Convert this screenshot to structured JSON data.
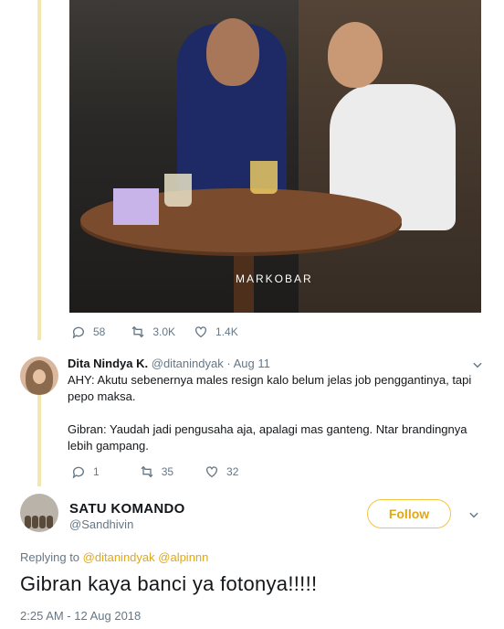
{
  "photo": {
    "watermark": "MARKOBAR"
  },
  "top_tweet_actions": {
    "replies": "58",
    "retweets": "3.0K",
    "likes": "1.4K"
  },
  "reply": {
    "display_name": "Dita Nindya K.",
    "handle": "@ditanindyak",
    "separator": "·",
    "date": "Aug 11",
    "paragraph_1": "AHY: Akutu sebenernya males resign kalo belum jelas job penggantinya, tapi pepo maksa.",
    "paragraph_2": "Gibran: Yaudah jadi pengusaha aja, apalagi mas ganteng. Ntar brandingnya lebih gampang.",
    "replies": "1",
    "retweets": "35",
    "likes": "32"
  },
  "main_tweet": {
    "display_name": "SATU KOMANDO",
    "handle": "@Sandhivin",
    "follow_label": "Follow",
    "replying_to_label": "Replying to",
    "replying_to_1": "@ditanindyak",
    "replying_to_2": "@alpinnn",
    "text": "Gibran kaya banci ya fotonya!!!!!",
    "timestamp": "2:25 AM - 12 Aug 2018"
  },
  "icons": {
    "reply": "reply-icon",
    "retweet": "retweet-icon",
    "like": "heart-icon",
    "menu": "chevron-down-icon"
  },
  "colors": {
    "thread_line": "#f3e7b0",
    "follow_accent": "#e0a817",
    "secondary_text": "#657786"
  }
}
